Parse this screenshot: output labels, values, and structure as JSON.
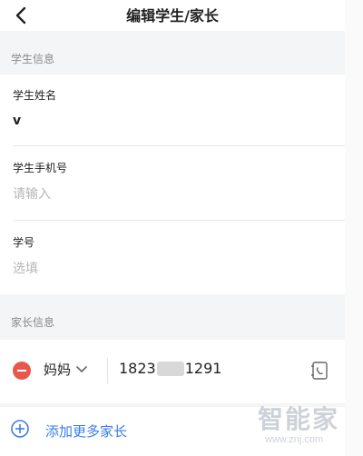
{
  "header": {
    "title": "编辑学生/家长"
  },
  "student_section": {
    "label": "学生信息",
    "fields": [
      {
        "label": "学生姓名",
        "value": "v"
      },
      {
        "label": "学生手机号",
        "placeholder": "请输入"
      },
      {
        "label": "学号",
        "placeholder": "选填"
      }
    ]
  },
  "parent_section": {
    "label": "家长信息",
    "parents": [
      {
        "relation": "妈妈",
        "phone_prefix": "1823",
        "phone_suffix": "1291"
      }
    ],
    "add_label": "添加更多家长"
  },
  "watermark": {
    "text": "智能家",
    "sub": "www.znj.com"
  },
  "colors": {
    "accent": "#3a7ee6",
    "danger": "#e8574d",
    "muted": "#8a8a8a"
  },
  "icons": [
    "back-arrow-icon",
    "remove-circle-icon",
    "chevron-down-icon",
    "contacts-book-icon",
    "add-circle-icon"
  ]
}
